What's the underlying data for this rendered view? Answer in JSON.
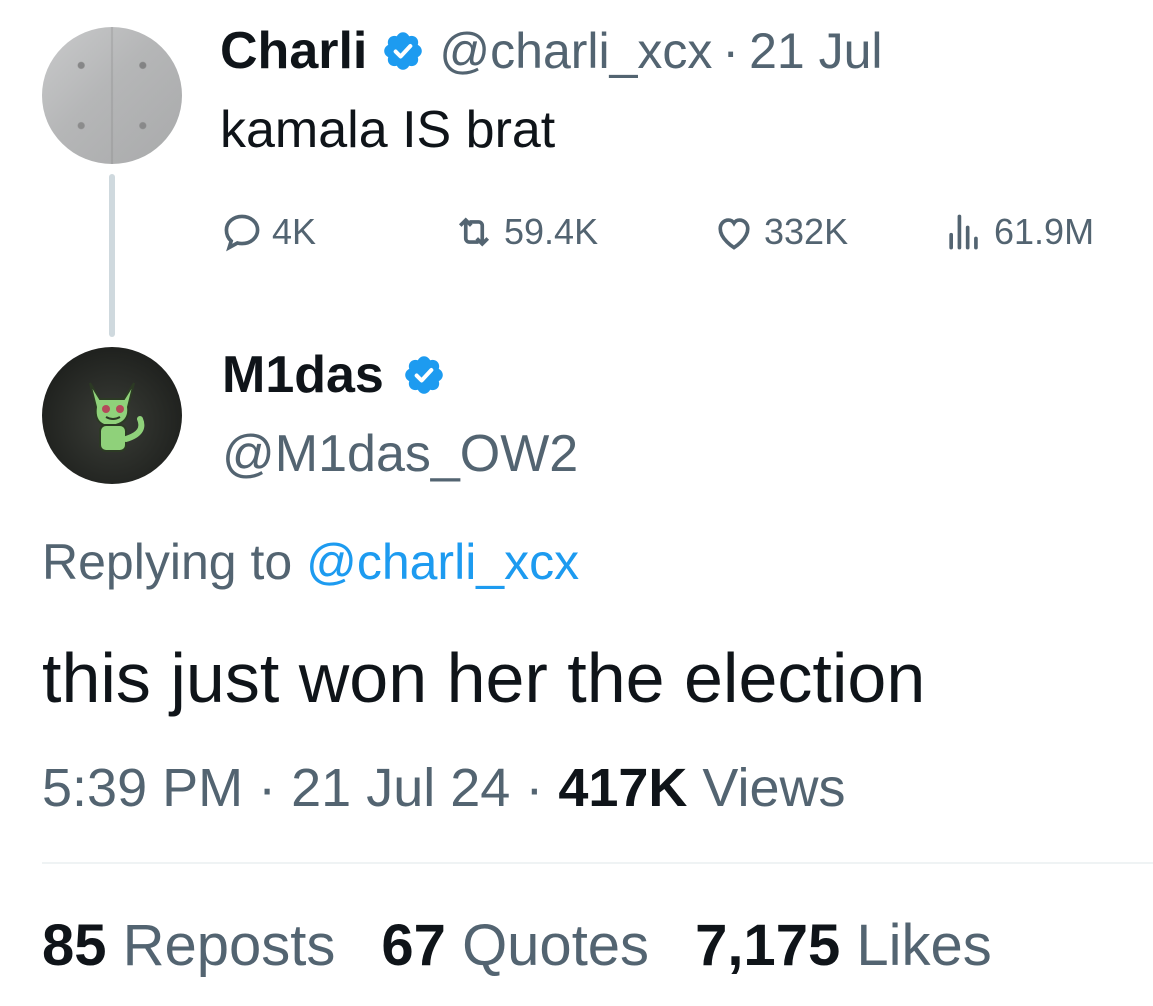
{
  "parent_tweet": {
    "name": "Charli",
    "handle": "@charli_xcx",
    "separator": "·",
    "date": "21 Jul",
    "text": "kamala IS brat",
    "actions": {
      "replies": "4K",
      "reposts": "59.4K",
      "likes": "332K",
      "views": "61.9M"
    }
  },
  "reply_tweet": {
    "name": "M1das",
    "handle": "@M1das_OW2",
    "replying_prefix": "Replying to",
    "replying_handle": "@charli_xcx",
    "text": "this just won her the election",
    "time": "5:39 PM",
    "separator": "·",
    "date": "21 Jul 24",
    "views_count": "417K",
    "views_label": "Views",
    "stats": {
      "reposts_count": "85",
      "reposts_label": "Reposts",
      "quotes_count": "67",
      "quotes_label": "Quotes",
      "likes_count": "7,175",
      "likes_label": "Likes"
    }
  },
  "colors": {
    "text": "#0f1419",
    "muted": "#536471",
    "link": "#1d9bf0",
    "verified": "#1d9bf0",
    "thread_line": "#cfd9de"
  },
  "icons": [
    "verified-badge-icon",
    "reply-icon",
    "repost-icon",
    "like-icon",
    "views-icon"
  ]
}
